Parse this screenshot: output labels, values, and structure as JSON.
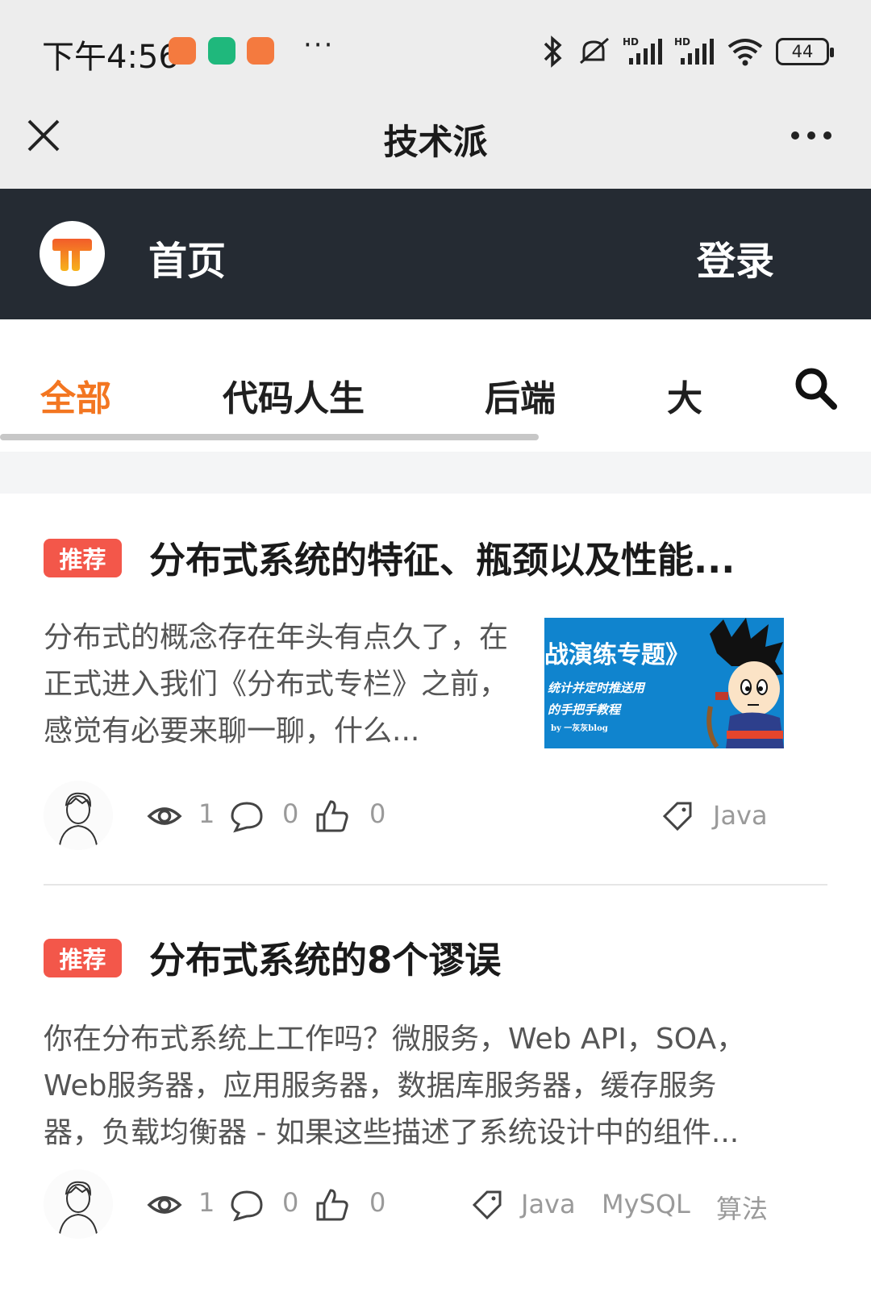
{
  "status_bar": {
    "time": "下午4:56",
    "overflow": "···",
    "battery": "44",
    "icons": [
      "bluetooth-icon",
      "mute-icon",
      "hd-signal-icon",
      "hd-signal-icon",
      "wifi-icon",
      "battery-icon"
    ],
    "app_colors": [
      "#f47a3f",
      "#1fb87c",
      "#f47a3f"
    ]
  },
  "nav": {
    "title": "技术派",
    "close_icon": "close-icon",
    "more_icon": "more-icon"
  },
  "header": {
    "home": "首页",
    "login": "登录",
    "logo_color": "#f39c12"
  },
  "tabs": {
    "items": [
      {
        "label": "全部",
        "active": true
      },
      {
        "label": "代码人生",
        "active": false
      },
      {
        "label": "后端",
        "active": false
      },
      {
        "label": "大",
        "active": false
      }
    ],
    "active_color": "#f37621",
    "search_icon": "search-icon"
  },
  "articles": [
    {
      "badge": "推荐",
      "title": "分布式系统的特征、瓶颈以及性能...",
      "summary": "分布式的概念存在年头有点久了，在正式进入我们《分布式专栏》之前，感觉有必要来聊一聊，什么...",
      "thumbnail": {
        "line1": "战演练专题》",
        "line2": "统计并定时推送用",
        "line3": "的手把手教程",
        "line4": "by 一灰灰blog"
      },
      "views": "1",
      "comments": "0",
      "likes": "0",
      "tags": [
        "Java"
      ]
    },
    {
      "badge": "推荐",
      "title": "分布式系统的8个谬误",
      "summary": "你在分布式系统上工作吗？微服务，Web API，SOA，Web服务器，应用服务器，数据库服务器，缓存服务器，负载均衡器 - 如果这些描述了系统设计中的组件...",
      "views": "1",
      "comments": "0",
      "likes": "0",
      "tags": [
        "Java",
        "MySQL",
        "算法"
      ]
    }
  ]
}
